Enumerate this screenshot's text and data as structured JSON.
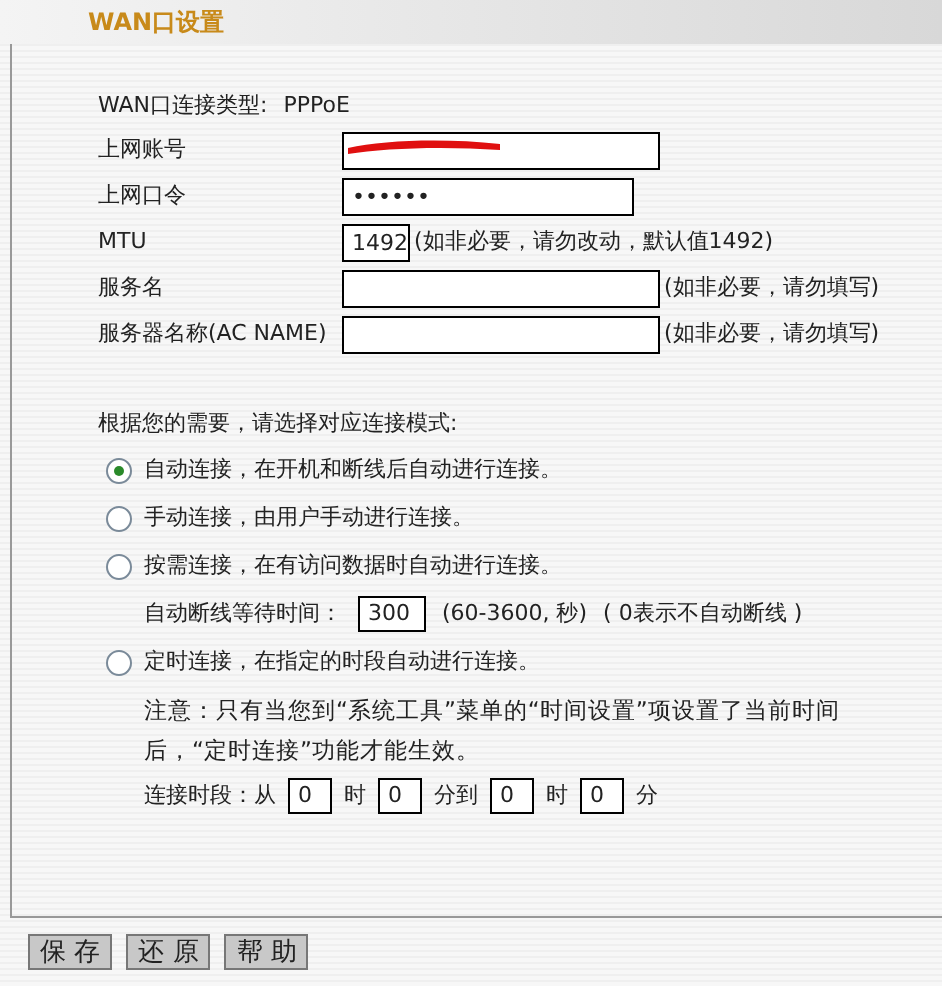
{
  "header": {
    "title": "WAN口设置"
  },
  "connection_type": {
    "label": "WAN口连接类型:",
    "value": "PPPoE"
  },
  "fields": [
    {
      "label": "上网账号",
      "redacted": true,
      "kind": "text"
    },
    {
      "label": "上网口令",
      "value": "••••••",
      "kind": "password"
    },
    {
      "label": "MTU",
      "value": "1492",
      "kind": "number",
      "hint": "(如非必要，请勿改动，默认值1492)"
    },
    {
      "label": "服务名",
      "kind": "text",
      "hint": "(如非必要，请勿填写)"
    },
    {
      "label": "服务器名称(AC NAME)",
      "kind": "text",
      "hint": "(如非必要，请勿填写)"
    }
  ],
  "mode_prompt": "根据您的需要，请选择对应连接模式:",
  "modes": [
    {
      "label": "自动连接，在开机和断线后自动进行连接。",
      "selected": true
    },
    {
      "label": "手动连接，由用户手动进行连接。",
      "selected": false
    },
    {
      "label": "按需连接，在有访问数据时自动进行连接。",
      "selected": false,
      "idle": {
        "label": "自动断线等待时间：",
        "value": "300",
        "range": "(60-3600, 秒)",
        "note": "( 0表示不自动断线 )"
      }
    },
    {
      "label": "定时连接，在指定的时段自动进行连接。",
      "selected": false,
      "note": "注意：只有当您到“系统工具”菜单的“时间设置”项设置了当前时间后，“定时连接”功能才能生效。",
      "period": {
        "label": "连接时段：从",
        "parts": [
          {
            "value": "0",
            "unit": "时"
          },
          {
            "value": "0",
            "unit": "分到"
          },
          {
            "value": "0",
            "unit": "时"
          },
          {
            "value": "0",
            "unit": "分"
          }
        ]
      }
    }
  ],
  "buttons": [
    "保 存",
    "还 原",
    "帮 助"
  ]
}
